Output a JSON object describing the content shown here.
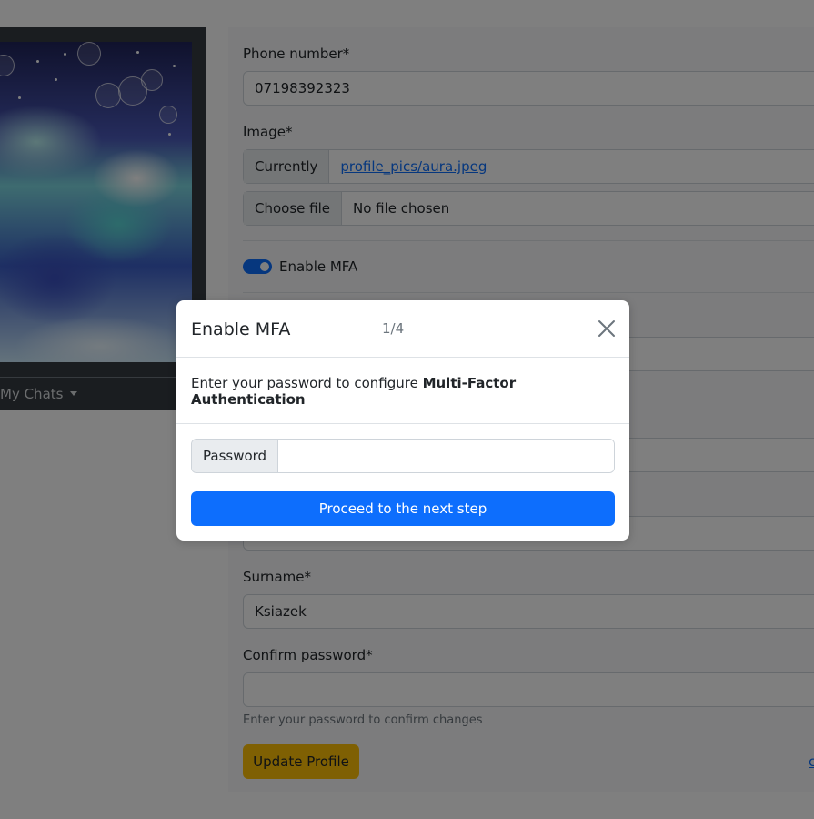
{
  "sidebar": {
    "my_chats_label": "My Chats"
  },
  "form": {
    "phone": {
      "label": "Phone number*",
      "value": "07198392323"
    },
    "image": {
      "label": "Image*",
      "currently_label": "Currently",
      "current_file": "profile_pics/aura.jpeg",
      "choose_file_label": "Choose file",
      "no_file_label": "No file chosen"
    },
    "mfa_toggle_label": "Enable MFA",
    "mfa_enabled": true,
    "surname": {
      "label": "Surname*",
      "value": "Ksiazek"
    },
    "confirm_password": {
      "label": "Confirm password*",
      "value": "",
      "help": "Enter your password to confirm changes"
    },
    "update_button": "Update Profile",
    "cutoff_link": "c"
  },
  "modal": {
    "title": "Enable MFA",
    "step": "1/4",
    "description_prefix": "Enter your password to configure ",
    "description_bold": "Multi-Factor Authentication",
    "password_label": "Password",
    "password_value": "",
    "proceed_button": "Proceed to the next step"
  },
  "colors": {
    "primary": "#0d6efd",
    "warning": "#ffc107",
    "dark_card": "#343a40"
  }
}
